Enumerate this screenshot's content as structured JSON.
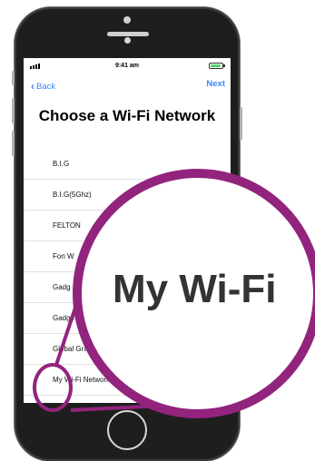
{
  "status_bar": {
    "time": "9:41 am"
  },
  "nav": {
    "back_label": "Back",
    "next_label": "Next"
  },
  "title": "Choose a Wi-Fi Network",
  "networks": [
    {
      "name": "B.I.G"
    },
    {
      "name": "B.I.G(5Ghz)"
    },
    {
      "name": "FELTON"
    },
    {
      "name": "Fon W"
    },
    {
      "name": "Gadg"
    },
    {
      "name": "Gadge"
    },
    {
      "name": "Global Grap"
    },
    {
      "name": "My Wi-Fi Network"
    }
  ],
  "magnifier": {
    "text": "My Wi-Fi"
  },
  "colors": {
    "accent": "#3a87ff",
    "highlight": "#92247e",
    "battery": "#4cd964"
  },
  "icons": {
    "back": "chevron-left-icon",
    "signal": "signal-bars-icon",
    "battery": "battery-icon"
  }
}
